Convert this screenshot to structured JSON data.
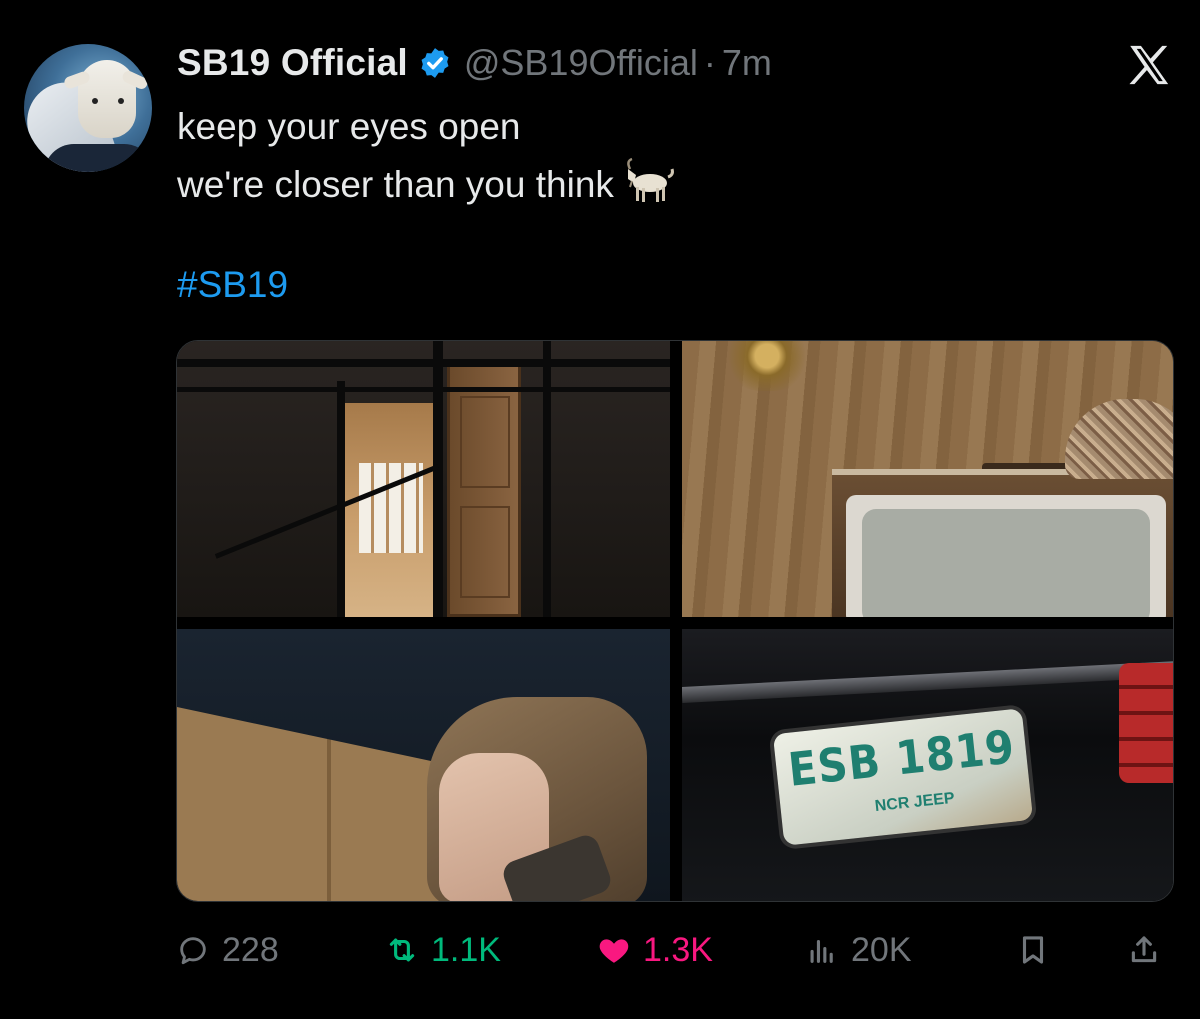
{
  "tweet": {
    "display_name": "SB19 Official",
    "handle": "@SB19Official",
    "separator": "·",
    "time": "7m",
    "verified": true,
    "line1": "keep your eyes open",
    "line2": "we're closer than you think",
    "emoji": "goat-emoji",
    "hashtag": "#SB19"
  },
  "media": {
    "plate_number": "ESB 1819",
    "plate_sub": "NCR JEEP"
  },
  "actions": {
    "replies": "228",
    "retweets": "1.1K",
    "likes": "1.3K",
    "views": "20K"
  },
  "colors": {
    "background": "#000000",
    "text": "#e7e9ea",
    "muted": "#71767b",
    "link": "#1d9bf0",
    "verified": "#1d9bf0",
    "retweet": "#00ba7c",
    "like": "#f91880"
  },
  "icons": [
    "x-logo-icon",
    "verified-badge-icon",
    "reply-icon",
    "retweet-icon",
    "heart-icon",
    "views-icon",
    "bookmark-icon",
    "share-icon"
  ]
}
